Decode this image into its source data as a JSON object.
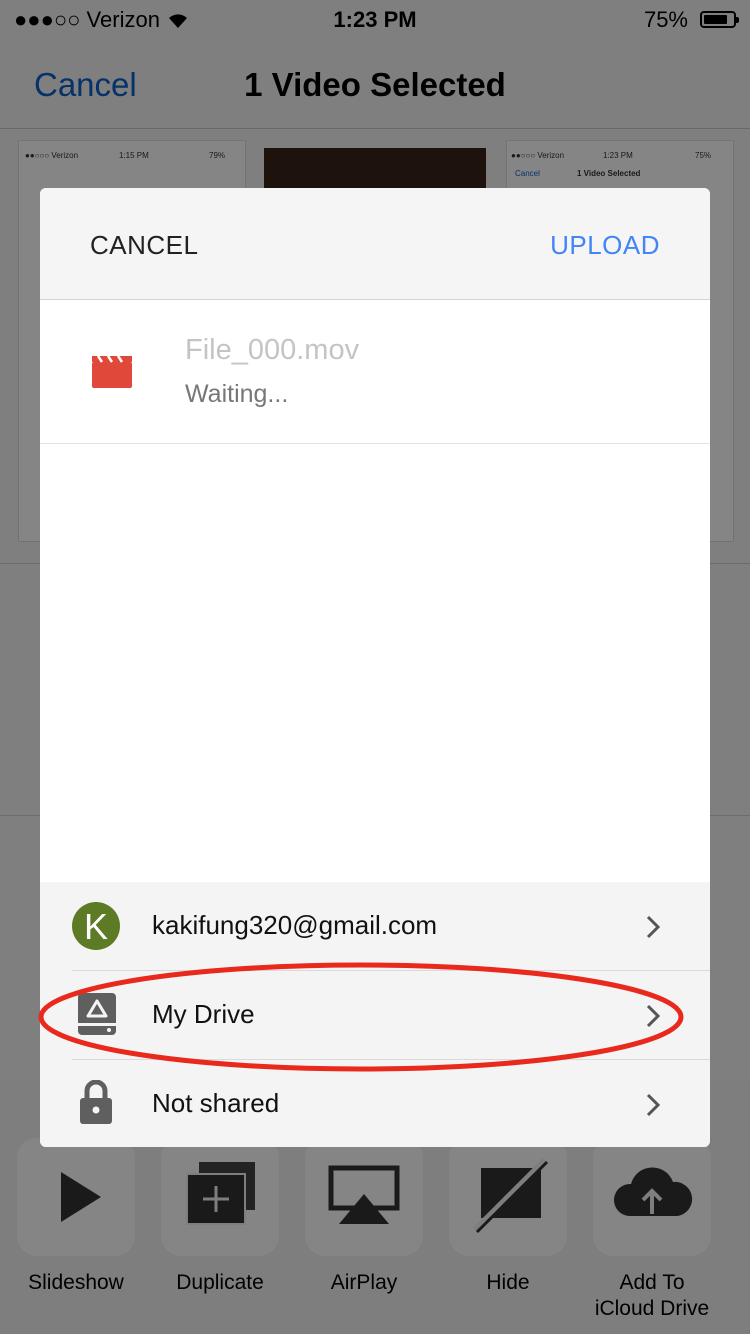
{
  "status_bar": {
    "carrier": "●●●○○ Verizon",
    "time": "1:23 PM",
    "battery": "75%"
  },
  "nav": {
    "cancel": "Cancel",
    "title": "1 Video Selected"
  },
  "thumbnail_text": {
    "carrier": "●●○○○ Verizon",
    "time_left": "1:15 PM",
    "battery_left": "79%",
    "time_right": "1:23 PM",
    "battery_right": "75%",
    "cancel_right": "Cancel",
    "title_right": "1 Video Selected"
  },
  "actions": [
    {
      "label": "Slideshow",
      "icon": "play-icon"
    },
    {
      "label": "Duplicate",
      "icon": "duplicate-icon"
    },
    {
      "label": "AirPlay",
      "icon": "airplay-icon"
    },
    {
      "label": "Hide",
      "icon": "hide-icon"
    },
    {
      "label": "Add To\niCloud Drive",
      "icon": "icloud-upload-icon"
    }
  ],
  "dialog": {
    "cancel": "CANCEL",
    "upload": "UPLOAD",
    "file": {
      "name": "File_000.mov",
      "status": "Waiting...",
      "icon": "video-file-icon"
    },
    "account": {
      "avatar_letter": "K",
      "email": "kakifung320@gmail.com"
    },
    "folder": {
      "label": "My Drive",
      "icon": "drive-icon"
    },
    "sharing": {
      "label": "Not shared",
      "icon": "lock-icon"
    }
  },
  "colors": {
    "accent_blue": "#4285f4",
    "ios_blue": "#0a60c8",
    "annotation_red": "#e8291c",
    "file_icon_red": "#e0483a",
    "avatar_green": "#5d7a24"
  }
}
